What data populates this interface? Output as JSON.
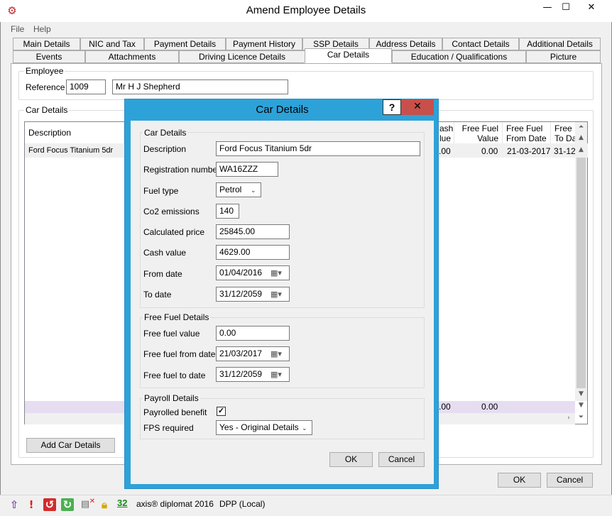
{
  "window": {
    "title": "Amend Employee Details",
    "minimize": "—",
    "maximize": "☐",
    "close": "✕"
  },
  "menu": {
    "file": "File",
    "help": "Help"
  },
  "tabs_row1": [
    "Main Details",
    "NIC and Tax",
    "Payment Details",
    "Payment History",
    "SSP Details",
    "Address Details",
    "Contact Details",
    "Additional Details"
  ],
  "tabs_row2": [
    "Events",
    "Attachments",
    "Driving Licence Details",
    "Car Details",
    "Education / Qualifications",
    "Picture"
  ],
  "active_tab": "Car Details",
  "employee": {
    "group_label": "Employee",
    "reference_label": "Reference",
    "reference_value": "1009",
    "name_value": "Mr H J Shepherd"
  },
  "car_details": {
    "group_label": "Car Details",
    "columns": {
      "description": "Description",
      "cash_value_1": "ash",
      "cash_value_2": "lue",
      "free_fuel_value_1": "Free Fuel",
      "free_fuel_value_2": "Value",
      "free_fuel_from_1": "Free Fuel",
      "free_fuel_from_2": "From Date",
      "free_fuel_to_1": "Free F",
      "free_fuel_to_2": "To Da"
    },
    "row": {
      "description": "Ford Focus Titanium 5dr",
      "cash_value": ".00",
      "free_fuel_value": "0.00",
      "free_fuel_from": "21-03-2017",
      "free_fuel_to": "31-12-"
    },
    "totals": {
      "cash_value": ".00",
      "free_fuel_value": "0.00"
    },
    "add_button": "Add Car Details"
  },
  "buttons": {
    "ok": "OK",
    "cancel": "Cancel"
  },
  "statusbar": {
    "count": "32",
    "product": "axis® diplomat 2016",
    "db": "DPP (Local)"
  },
  "dialog": {
    "title": "Car Details",
    "help": "?",
    "close": "✕",
    "section_car": "Car Details",
    "description_label": "Description",
    "description_value": "Ford Focus Titanium 5dr",
    "registration_label": "Registration number",
    "registration_value": "WA16ZZZ",
    "fuel_type_label": "Fuel type",
    "fuel_type_value": "Petrol",
    "co2_label": "Co2 emissions",
    "co2_value": "140",
    "calc_price_label": "Calculated price",
    "calc_price_value": "25845.00",
    "cash_value_label": "Cash value",
    "cash_value_value": "4629.00",
    "from_date_label": "From date",
    "from_date_value": "01/04/2016",
    "to_date_label": "To date",
    "to_date_value": "31/12/2059",
    "section_fuel": "Free Fuel Details",
    "ff_value_label": "Free fuel value",
    "ff_value_value": "0.00",
    "ff_from_label": "Free fuel from date",
    "ff_from_value": "21/03/2017",
    "ff_to_label": "Free fuel to date",
    "ff_to_value": "31/12/2059",
    "section_payroll": "Payroll Details",
    "payrolled_label": "Payrolled benefit",
    "payrolled_checked": "✓",
    "fps_label": "FPS required",
    "fps_value": "Yes - Original Details",
    "ok": "OK",
    "cancel": "Cancel"
  }
}
